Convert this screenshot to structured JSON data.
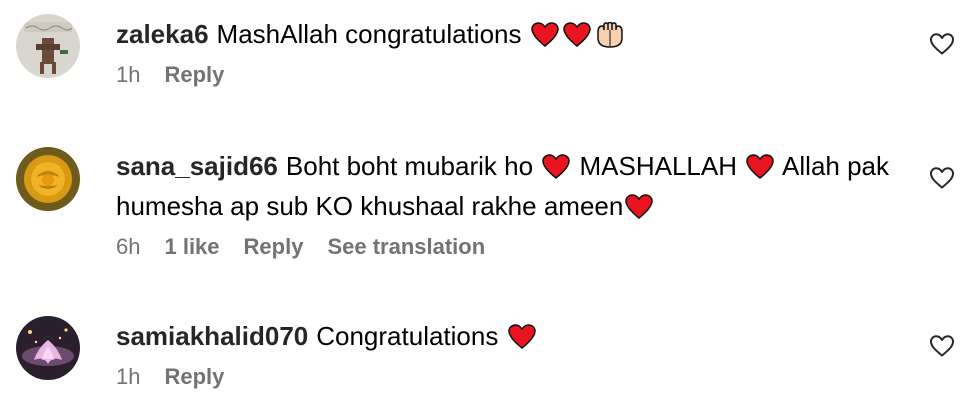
{
  "comments": [
    {
      "username": "zaleka6",
      "text_parts": [
        "MashAllah congratulations"
      ],
      "time": "1h",
      "reply_label": "Reply"
    },
    {
      "username": "sana_sajid66",
      "text_parts": [
        "Boht boht mubarik ho",
        "MASHALLAH",
        "Allah pak humesha ap sub KO khushaal rakhe ameen"
      ],
      "time": "6h",
      "likes": "1 like",
      "reply_label": "Reply",
      "translate_label": "See translation"
    },
    {
      "username": "samiakhalid070",
      "text_parts": [
        "Congratulations"
      ],
      "time": "1h",
      "reply_label": "Reply"
    }
  ],
  "icons": {
    "like": "heart-outline-icon",
    "heart_emoji": "red-heart-emoji",
    "hands_emoji": "palms-up-together-emoji"
  },
  "colors": {
    "heart_red": "#e8141f",
    "meta_gray": "#737373",
    "username": "#262626"
  }
}
